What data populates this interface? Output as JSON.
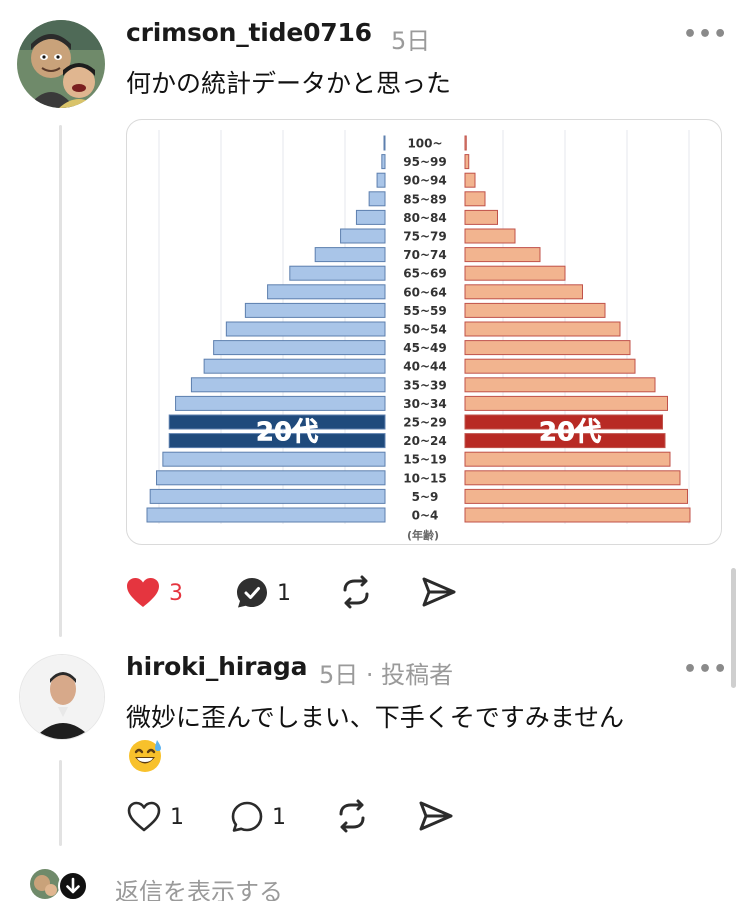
{
  "comments": [
    {
      "username": "crimson_tide0716",
      "time": "5日",
      "text": "何かの統計データかと思った",
      "likes": "3",
      "replies": "1"
    },
    {
      "username": "hiroki_hiraga",
      "time": "5日 · 投稿者",
      "text": "微妙に歪んでしまい、下手くそですみません",
      "likes": "1",
      "replies": "1"
    }
  ],
  "more_label": "•••",
  "chart_data": {
    "type": "bar",
    "categories": [
      "100~",
      "95~99",
      "90~94",
      "85~89",
      "80~84",
      "75~79",
      "70~74",
      "65~69",
      "60~64",
      "55~59",
      "50~54",
      "45~49",
      "40~44",
      "35~39",
      "30~34",
      "25~29",
      "20~24",
      "15~19",
      "10~15",
      "5~9",
      "0~4"
    ],
    "series": [
      {
        "values": [
          0.2,
          1,
          2.5,
          5,
          9,
          14,
          22,
          30,
          37,
          44,
          50,
          54,
          57,
          61,
          66,
          68,
          68,
          70,
          72,
          74,
          75
        ]
      },
      {
        "values": [
          0.5,
          1.5,
          4,
          8,
          13,
          20,
          30,
          40,
          47,
          56,
          62,
          66,
          68,
          76,
          81,
          79,
          80,
          82,
          86,
          89,
          90
        ]
      }
    ],
    "highlight_label": "20代",
    "xlabel": "(年齢)",
    "colors": {
      "left": "#a9c5e8",
      "left_border": "#5d7fae",
      "left_highlight": "#1f4a7c",
      "right": "#f2b48f",
      "right_border": "#c0524a",
      "right_highlight": "#b82a24"
    }
  },
  "reply_link": "返信を表示する",
  "emoji": "grinning-face-with-sweat"
}
